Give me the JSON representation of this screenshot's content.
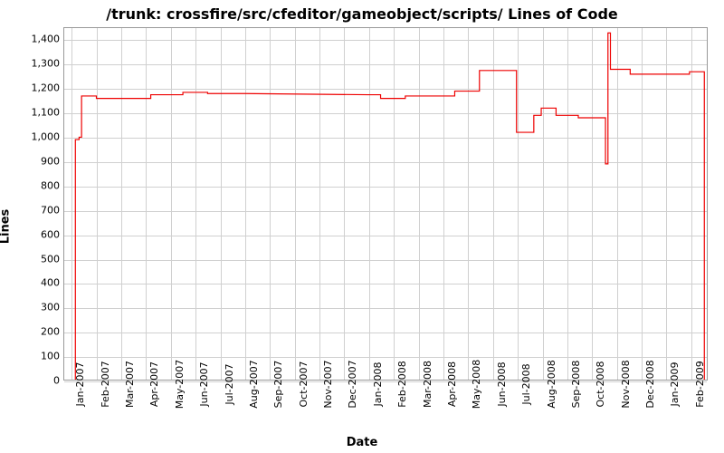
{
  "chart_data": {
    "type": "line",
    "title": "/trunk: crossfire/src/cfeditor/gameobject/scripts/ Lines of Code",
    "xlabel": "Date",
    "ylabel": "Lines",
    "ylim": [
      0,
      1450
    ],
    "y_ticks": [
      0,
      100,
      200,
      300,
      400,
      500,
      600,
      700,
      800,
      900,
      1000,
      1100,
      1200,
      1300,
      1400
    ],
    "x_categories": [
      "Jan-2007",
      "Feb-2007",
      "Mar-2007",
      "Apr-2007",
      "May-2007",
      "Jun-2007",
      "Jul-2007",
      "Aug-2007",
      "Sep-2007",
      "Oct-2007",
      "Nov-2007",
      "Dec-2007",
      "Jan-2008",
      "Feb-2008",
      "Mar-2008",
      "Apr-2008",
      "May-2008",
      "Jun-2008",
      "Jul-2008",
      "Aug-2008",
      "Sep-2008",
      "Oct-2008",
      "Nov-2008",
      "Dec-2008",
      "Jan-2009",
      "Feb-2009"
    ],
    "series": [
      {
        "name": "Lines of Code",
        "color": "#ee0000",
        "points": [
          {
            "xi": 0.15,
            "y": 0
          },
          {
            "xi": 0.15,
            "y": 990
          },
          {
            "xi": 0.3,
            "y": 990
          },
          {
            "xi": 0.3,
            "y": 1000
          },
          {
            "xi": 0.4,
            "y": 1000
          },
          {
            "xi": 0.4,
            "y": 1170
          },
          {
            "xi": 1.0,
            "y": 1170
          },
          {
            "xi": 1.0,
            "y": 1160
          },
          {
            "xi": 3.2,
            "y": 1160
          },
          {
            "xi": 3.2,
            "y": 1175
          },
          {
            "xi": 4.5,
            "y": 1175
          },
          {
            "xi": 4.5,
            "y": 1185
          },
          {
            "xi": 5.5,
            "y": 1185
          },
          {
            "xi": 5.5,
            "y": 1180
          },
          {
            "xi": 7.0,
            "y": 1180
          },
          {
            "xi": 7.0,
            "y": 1180
          },
          {
            "xi": 12.0,
            "y": 1175
          },
          {
            "xi": 12.5,
            "y": 1175
          },
          {
            "xi": 12.5,
            "y": 1160
          },
          {
            "xi": 13.5,
            "y": 1160
          },
          {
            "xi": 13.5,
            "y": 1170
          },
          {
            "xi": 15.5,
            "y": 1170
          },
          {
            "xi": 15.5,
            "y": 1190
          },
          {
            "xi": 16.5,
            "y": 1190
          },
          {
            "xi": 16.5,
            "y": 1275
          },
          {
            "xi": 18.0,
            "y": 1275
          },
          {
            "xi": 18.0,
            "y": 1020
          },
          {
            "xi": 18.7,
            "y": 1020
          },
          {
            "xi": 18.7,
            "y": 1090
          },
          {
            "xi": 19.0,
            "y": 1090
          },
          {
            "xi": 19.0,
            "y": 1120
          },
          {
            "xi": 19.6,
            "y": 1120
          },
          {
            "xi": 19.6,
            "y": 1090
          },
          {
            "xi": 20.5,
            "y": 1090
          },
          {
            "xi": 20.5,
            "y": 1080
          },
          {
            "xi": 21.6,
            "y": 1080
          },
          {
            "xi": 21.6,
            "y": 890
          },
          {
            "xi": 21.7,
            "y": 890
          },
          {
            "xi": 21.7,
            "y": 1430
          },
          {
            "xi": 21.8,
            "y": 1430
          },
          {
            "xi": 21.8,
            "y": 1280
          },
          {
            "xi": 22.6,
            "y": 1280
          },
          {
            "xi": 22.6,
            "y": 1260
          },
          {
            "xi": 25.0,
            "y": 1260
          },
          {
            "xi": 25.0,
            "y": 1270
          },
          {
            "xi": 25.6,
            "y": 1270
          },
          {
            "xi": 25.6,
            "y": 0
          }
        ]
      }
    ]
  }
}
